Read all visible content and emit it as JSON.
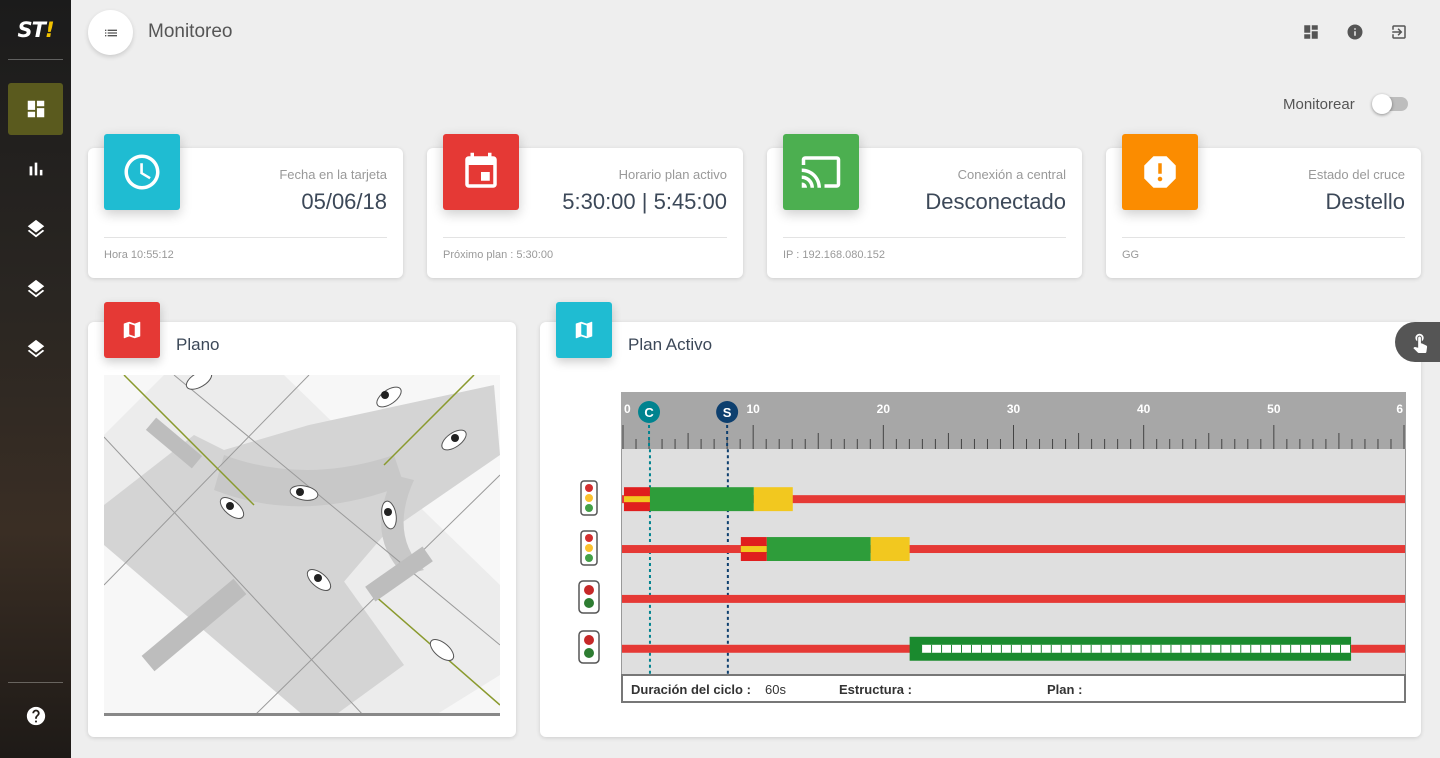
{
  "app": {
    "logo_text": "ST",
    "logo_mark": "!"
  },
  "header": {
    "title": "Monitoreo",
    "icons": [
      "dashboard-icon",
      "info-icon",
      "logout-icon"
    ]
  },
  "sidebar": {
    "items": [
      {
        "icon": "dashboard-icon",
        "active": true
      },
      {
        "icon": "chart-icon",
        "active": false
      },
      {
        "icon": "layers-icon",
        "active": false
      },
      {
        "icon": "layers-icon",
        "active": false
      },
      {
        "icon": "layers-icon",
        "active": false
      },
      {
        "icon": "help-icon",
        "active": false
      }
    ]
  },
  "monitor_toggle": {
    "label": "Monitorear",
    "on": false
  },
  "cards": [
    {
      "category": "Fecha en la tarjeta",
      "value": "05/06/18",
      "footer": "Hora 10:55:12",
      "color": "#1fbcd2",
      "icon": "clock-icon"
    },
    {
      "category": "Horario plan activo",
      "value": "5:30:00 | 5:45:00",
      "footer": "Próximo plan : 5:30:00",
      "color": "#e53935",
      "icon": "calendar-icon"
    },
    {
      "category": "Conexión a central",
      "value": "Desconectado",
      "footer": "IP : 192.168.080.152",
      "color": "#4caf50",
      "icon": "cast-icon"
    },
    {
      "category": "Estado del cruce",
      "value": "Destello",
      "footer": "GG",
      "color": "#fb8c00",
      "icon": "warning-icon"
    }
  ],
  "plano": {
    "title": "Plano",
    "color": "#e53935",
    "icon": "map-icon"
  },
  "plan_activo": {
    "title": "Plan Activo",
    "color": "#1fbcd2",
    "icon": "map-icon",
    "ruler_labels": [
      "0",
      "10",
      "20",
      "30",
      "40",
      "50",
      "6"
    ],
    "markers": [
      {
        "label": "C",
        "t": 2,
        "color": "#00838f"
      },
      {
        "label": "S",
        "t": 8,
        "color": "#0d3f6e"
      }
    ],
    "footer": {
      "cycle_label": "Duración del ciclo :",
      "cycle_value": "60s",
      "structure_label": "Estructura :",
      "plan_label": "Plan :"
    },
    "signals": [
      {
        "type": "vehicular",
        "segments": [
          {
            "color": "red-yellow",
            "from": 0,
            "to": 2
          },
          {
            "color": "green",
            "from": 2,
            "to": 10
          },
          {
            "color": "yellow",
            "from": 10,
            "to": 13
          }
        ]
      },
      {
        "type": "vehicular",
        "segments": [
          {
            "color": "red-yellow",
            "from": 9,
            "to": 11
          },
          {
            "color": "green",
            "from": 11,
            "to": 19
          },
          {
            "color": "yellow",
            "from": 19,
            "to": 22
          }
        ]
      },
      {
        "type": "pedestrian",
        "segments": []
      },
      {
        "type": "pedestrian",
        "segments": [
          {
            "color": "green-flash",
            "from": 22,
            "to": 56
          }
        ]
      }
    ]
  },
  "fab": {
    "icon": "touch-icon"
  }
}
